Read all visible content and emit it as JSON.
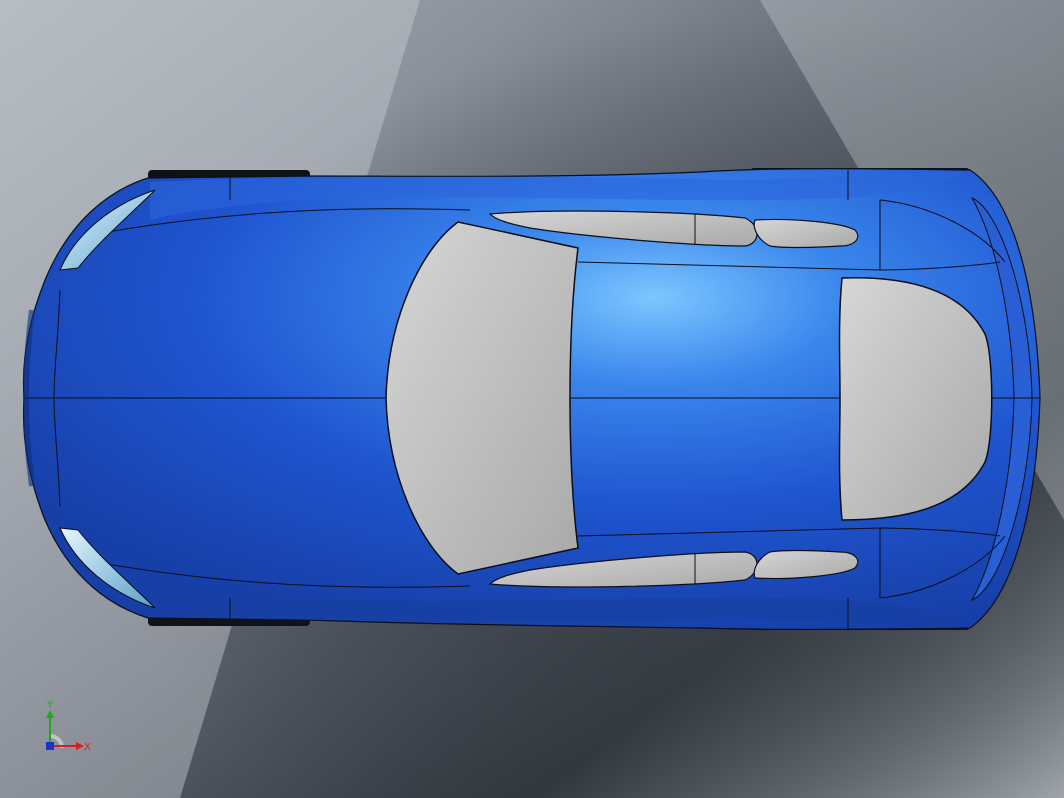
{
  "viewport": {
    "background_colors": [
      "#5d6570",
      "#8c939c",
      "#c6cad0",
      "#3f454d"
    ],
    "model_color": "#1f55d0",
    "model_highlight": "#7cc6ff",
    "glass_color": "#c8c8c8",
    "edge_color": "#0a0f1c"
  },
  "triad": {
    "x_label": "X",
    "y_label": "Y",
    "x_color": "#d62020",
    "y_color": "#1ea81e",
    "z_color": "#2030d0"
  }
}
